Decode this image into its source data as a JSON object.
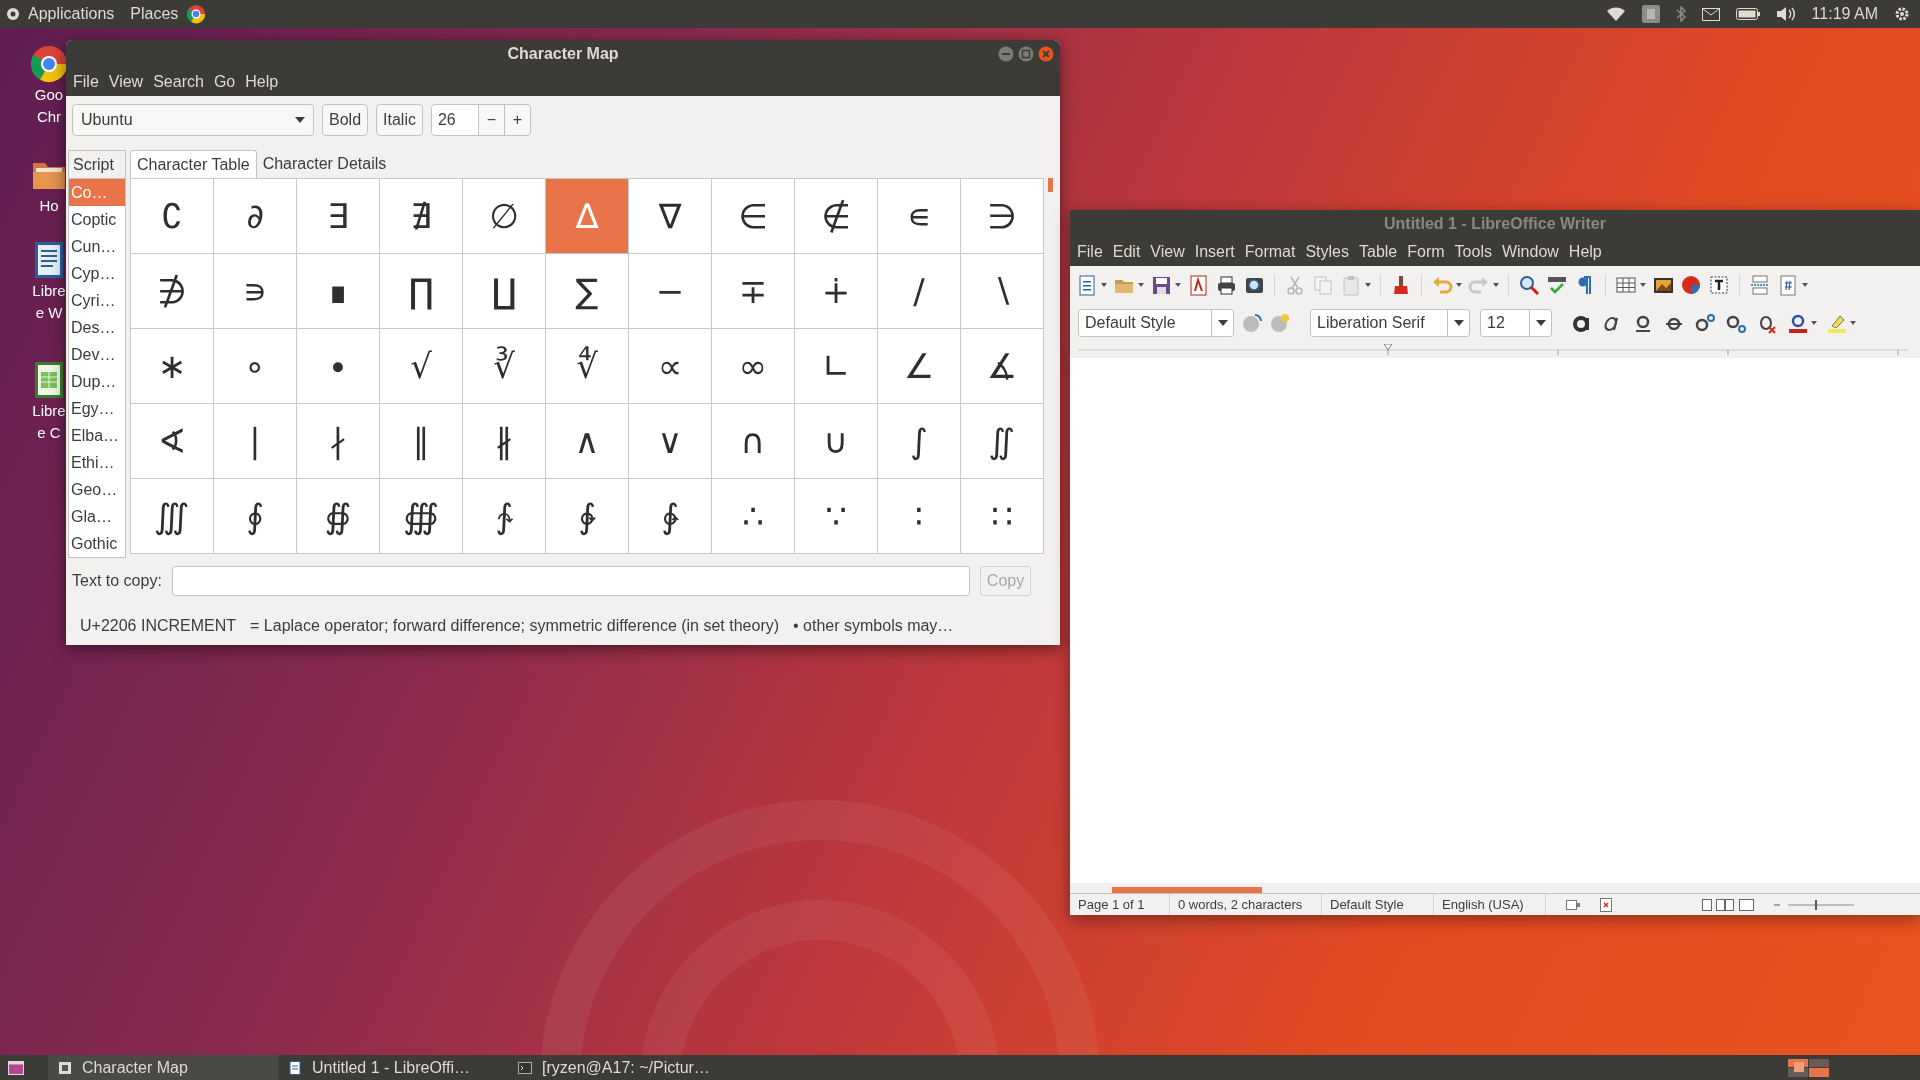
{
  "top_bar": {
    "menus": [
      "Applications",
      "Places"
    ],
    "clock": "11:19 AM"
  },
  "desktop_icons": [
    {
      "kind": "browser",
      "lines": [
        "Goo",
        "Chr"
      ]
    },
    {
      "kind": "folder",
      "lines": [
        "Ho"
      ]
    },
    {
      "kind": "writer",
      "lines": [
        "Libre",
        "e W"
      ]
    },
    {
      "kind": "calc",
      "lines": [
        "Libre",
        "e C"
      ]
    }
  ],
  "character_map": {
    "title": "Character Map",
    "menu": [
      "File",
      "View",
      "Search",
      "Go",
      "Help"
    ],
    "font": "Ubuntu",
    "bold": "Bold",
    "italic": "Italic",
    "size": "26",
    "decrease": "−",
    "increase": "+",
    "script_header": "Script",
    "scripts": [
      {
        "label": "Co…",
        "selected": true
      },
      {
        "label": "Coptic",
        "selected": false
      },
      {
        "label": "Cun…",
        "selected": false
      },
      {
        "label": "Cyp…",
        "selected": false
      },
      {
        "label": "Cyri…",
        "selected": false
      },
      {
        "label": "Des…",
        "selected": false
      },
      {
        "label": "Dev…",
        "selected": false
      },
      {
        "label": "Dup…",
        "selected": false
      },
      {
        "label": "Egy…",
        "selected": false
      },
      {
        "label": "Elba…",
        "selected": false
      },
      {
        "label": "Ethi…",
        "selected": false
      },
      {
        "label": "Geo…",
        "selected": false
      },
      {
        "label": "Gla…",
        "selected": false
      },
      {
        "label": "Gothic",
        "selected": false
      }
    ],
    "tabs": [
      {
        "label": "Character Table",
        "selected": true
      },
      {
        "label": "Character Details",
        "selected": false
      }
    ],
    "grid": [
      [
        {
          "char": "∁",
          "selected": false
        },
        {
          "char": "∂",
          "selected": false
        },
        {
          "char": "∃",
          "selected": false
        },
        {
          "char": "∄",
          "selected": false
        },
        {
          "char": "∅",
          "selected": false
        },
        {
          "char": "∆",
          "selected": true
        },
        {
          "char": "∇",
          "selected": false
        },
        {
          "char": "∈",
          "selected": false
        },
        {
          "char": "∉",
          "selected": false
        },
        {
          "char": "∊",
          "selected": false
        },
        {
          "char": "∋",
          "selected": false
        }
      ],
      [
        {
          "char": "∌",
          "selected": false
        },
        {
          "char": "∍",
          "selected": false
        },
        {
          "char": "∎",
          "selected": false
        },
        {
          "char": "∏",
          "selected": false
        },
        {
          "char": "∐",
          "selected": false
        },
        {
          "char": "∑",
          "selected": false
        },
        {
          "char": "−",
          "selected": false
        },
        {
          "char": "∓",
          "selected": false
        },
        {
          "char": "∔",
          "selected": false
        },
        {
          "char": "∕",
          "selected": false
        },
        {
          "char": "∖",
          "selected": false
        }
      ],
      [
        {
          "char": "∗",
          "selected": false
        },
        {
          "char": "∘",
          "selected": false
        },
        {
          "char": "∙",
          "selected": false
        },
        {
          "char": "√",
          "selected": false
        },
        {
          "char": "∛",
          "selected": false
        },
        {
          "char": "∜",
          "selected": false
        },
        {
          "char": "∝",
          "selected": false
        },
        {
          "char": "∞",
          "selected": false
        },
        {
          "char": "∟",
          "selected": false
        },
        {
          "char": "∠",
          "selected": false
        },
        {
          "char": "∡",
          "selected": false
        }
      ],
      [
        {
          "char": "∢",
          "selected": false
        },
        {
          "char": "∣",
          "selected": false
        },
        {
          "char": "∤",
          "selected": false
        },
        {
          "char": "∥",
          "selected": false
        },
        {
          "char": "∦",
          "selected": false
        },
        {
          "char": "∧",
          "selected": false
        },
        {
          "char": "∨",
          "selected": false
        },
        {
          "char": "∩",
          "selected": false
        },
        {
          "char": "∪",
          "selected": false
        },
        {
          "char": "∫",
          "selected": false
        },
        {
          "char": "∬",
          "selected": false
        }
      ],
      [
        {
          "char": "∭",
          "selected": false
        },
        {
          "char": "∮",
          "selected": false
        },
        {
          "char": "∯",
          "selected": false
        },
        {
          "char": "∰",
          "selected": false
        },
        {
          "char": "∱",
          "selected": false
        },
        {
          "char": "∲",
          "selected": false
        },
        {
          "char": "∳",
          "selected": false
        },
        {
          "char": "∴",
          "selected": false
        },
        {
          "char": "∵",
          "selected": false
        },
        {
          "char": "∶",
          "selected": false
        },
        {
          "char": "∷",
          "selected": false
        }
      ]
    ],
    "copy_label": "Text to copy:",
    "copy_button": "Copy",
    "copy_disabled": true,
    "status": [
      "U+2206 INCREMENT",
      "= Laplace operator; forward difference; symmetric difference (in set theory)",
      "• other symbols may…"
    ]
  },
  "writer": {
    "title": "Untitled 1 - LibreOffice Writer",
    "menu": [
      "File",
      "Edit",
      "View",
      "Insert",
      "Format",
      "Styles",
      "Table",
      "Form",
      "Tools",
      "Window",
      "Help"
    ],
    "paragraph_style": "Default Style",
    "font": "Liberation Serif",
    "size": "12",
    "status": [
      "Page 1 of 1",
      "0 words, 2 characters",
      "Default Style",
      "English (USA)"
    ]
  },
  "taskbar": [
    {
      "kind": "charmap",
      "label": "Character Map"
    },
    {
      "kind": "writer",
      "label": "Untitled 1 - LibreOffi…"
    },
    {
      "kind": "terminal",
      "label": "[ryzen@A17: ~/Pictur…"
    }
  ]
}
